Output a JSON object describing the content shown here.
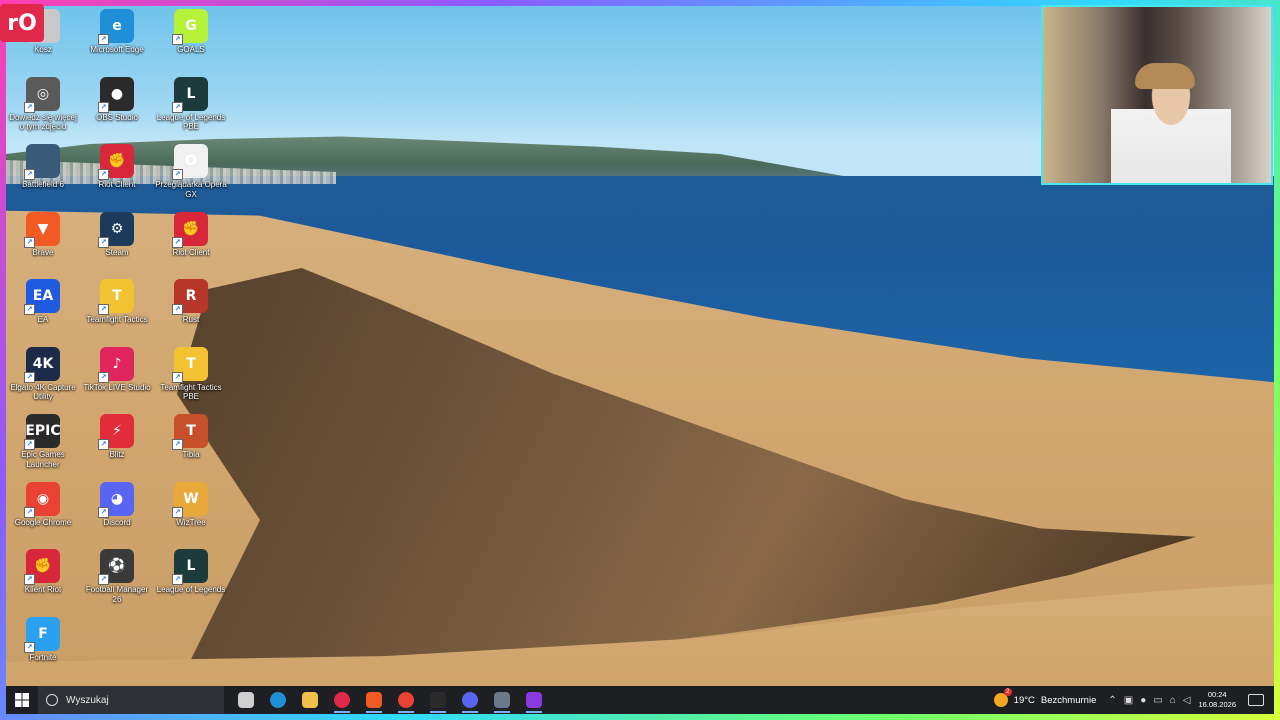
{
  "stream_logo": "rO",
  "desktop_icons": [
    {
      "label": "Kosz",
      "icon": "recycle-bin-icon",
      "color": "#c9c9c9",
      "glyph": ""
    },
    {
      "label": "Microsoft Edge",
      "icon": "edge-icon",
      "color": "#1f8fd8",
      "glyph": "e"
    },
    {
      "label": "GOALS",
      "icon": "goals-icon",
      "color": "#b6f23a",
      "glyph": "G"
    },
    {
      "label": "Dowiedz się więcej o tym zdjęciu",
      "icon": "camera-icon",
      "color": "#5a5a5a",
      "glyph": "◎"
    },
    {
      "label": "OBS Studio",
      "icon": "obs-icon",
      "color": "#2b2b2b",
      "glyph": "●"
    },
    {
      "label": "League of Legends PBE",
      "icon": "league-pbe-icon",
      "color": "#1d3b3b",
      "glyph": "L"
    },
    {
      "label": "Battlefield 6",
      "icon": "battlefield-icon",
      "color": "#3a5a7a",
      "glyph": ""
    },
    {
      "label": "Riot Client",
      "icon": "riot-client-icon",
      "color": "#d8263a",
      "glyph": "✊"
    },
    {
      "label": "Przeglądarka Opera GX",
      "icon": "opera-gx-icon",
      "color": "#f0f0f0",
      "glyph": "O"
    },
    {
      "label": "Brave",
      "icon": "brave-icon",
      "color": "#f25a24",
      "glyph": "▼"
    },
    {
      "label": "Steam",
      "icon": "steam-icon",
      "color": "#1b3a5c",
      "glyph": "⚙"
    },
    {
      "label": "Riot Client",
      "icon": "riot-client-icon",
      "color": "#d8263a",
      "glyph": "✊"
    },
    {
      "label": "EA",
      "icon": "ea-icon",
      "color": "#1f5be0",
      "glyph": "EA"
    },
    {
      "label": "Teamfight Tactics",
      "icon": "tft-icon",
      "color": "#f2c230",
      "glyph": "T"
    },
    {
      "label": "Rust",
      "icon": "rust-icon",
      "color": "#b8352a",
      "glyph": "R"
    },
    {
      "label": "Elgato 4K Capture Utility",
      "icon": "elgato-icon",
      "color": "#1c2b4a",
      "glyph": "4K"
    },
    {
      "label": "TikTok LIVE Studio",
      "icon": "tiktok-icon",
      "color": "#e0245e",
      "glyph": "♪"
    },
    {
      "label": "Teamfight Tactics PBE",
      "icon": "tft-pbe-icon",
      "color": "#f2c230",
      "glyph": "T"
    },
    {
      "label": "Epic Games Launcher",
      "icon": "epic-games-icon",
      "color": "#2a2a2a",
      "glyph": "EPIC"
    },
    {
      "label": "Blitz",
      "icon": "blitz-icon",
      "color": "#e22c3a",
      "glyph": "⚡"
    },
    {
      "label": "Tibia",
      "icon": "tibia-icon",
      "color": "#c7502a",
      "glyph": "T"
    },
    {
      "label": "Google Chrome",
      "icon": "chrome-icon",
      "color": "#e94235",
      "glyph": "◉"
    },
    {
      "label": "Discord",
      "icon": "discord-icon",
      "color": "#5865f2",
      "glyph": "◕"
    },
    {
      "label": "WizTree",
      "icon": "wiztree-icon",
      "color": "#e8a83a",
      "glyph": "W"
    },
    {
      "label": "Klient Riot",
      "icon": "riot-client-icon",
      "color": "#d8263a",
      "glyph": "✊"
    },
    {
      "label": "Football Manager 26",
      "icon": "football-manager-icon",
      "color": "#3a3a3a",
      "glyph": "⚽"
    },
    {
      "label": "League of Legends",
      "icon": "league-icon",
      "color": "#1d3b3b",
      "glyph": "L"
    },
    {
      "label": "Fortnite",
      "icon": "fortnite-icon",
      "color": "#2aa0f0",
      "glyph": "F"
    }
  ],
  "taskbar": {
    "search_placeholder": "Wyszukaj",
    "apps": [
      {
        "name": "task-view-icon",
        "color": "#cfcfcf"
      },
      {
        "name": "edge-icon",
        "color": "#1f8fd8"
      },
      {
        "name": "file-explorer-icon",
        "color": "#f2c04a"
      },
      {
        "name": "opera-gx-icon",
        "color": "#e0284a"
      },
      {
        "name": "brave-icon",
        "color": "#f25a24"
      },
      {
        "name": "chrome-icon",
        "color": "#e94235"
      },
      {
        "name": "obs-icon",
        "color": "#2b2b2b"
      },
      {
        "name": "discord-icon",
        "color": "#5865f2"
      },
      {
        "name": "steam-icon",
        "color": "#6a7a8a"
      },
      {
        "name": "clipchamp-icon",
        "color": "#8a3ae0"
      }
    ],
    "weather": {
      "temp": "19°C",
      "desc": "Bezchmurnie",
      "badge": "2"
    },
    "clock": {
      "time": "00:24",
      "date": "16.08.2026"
    }
  }
}
